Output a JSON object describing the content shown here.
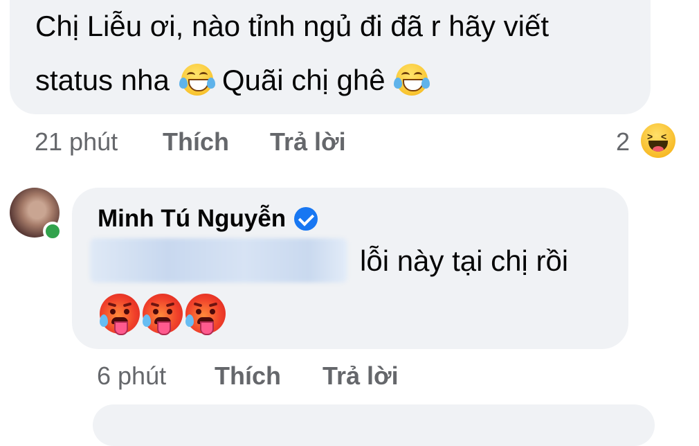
{
  "comment1": {
    "line1": "Chị Liễu ơi, nào tỉnh ngủ đi đã r hãy viết",
    "line2_part1": "status nha",
    "line2_part2": "Quãi chị ghê",
    "time": "21 phút",
    "like_label": "Thích",
    "reply_label": "Trả lời",
    "reaction_count": "2",
    "reaction_icon": "haha-reaction-icon",
    "emoji": "face-with-tears-of-joy"
  },
  "comment2": {
    "author": "Minh Tú Nguyễn",
    "verified_icon": "verified-badge-icon",
    "text": "lỗi này tại chị rồi",
    "emoji": "hot-face",
    "time": "6 phút",
    "like_label": "Thích",
    "reply_label": "Trả lời"
  },
  "colors": {
    "bubble": "#f0f2f5",
    "meta_text": "#65676b",
    "online_dot": "#31a24c",
    "verified": "#1877f2"
  }
}
